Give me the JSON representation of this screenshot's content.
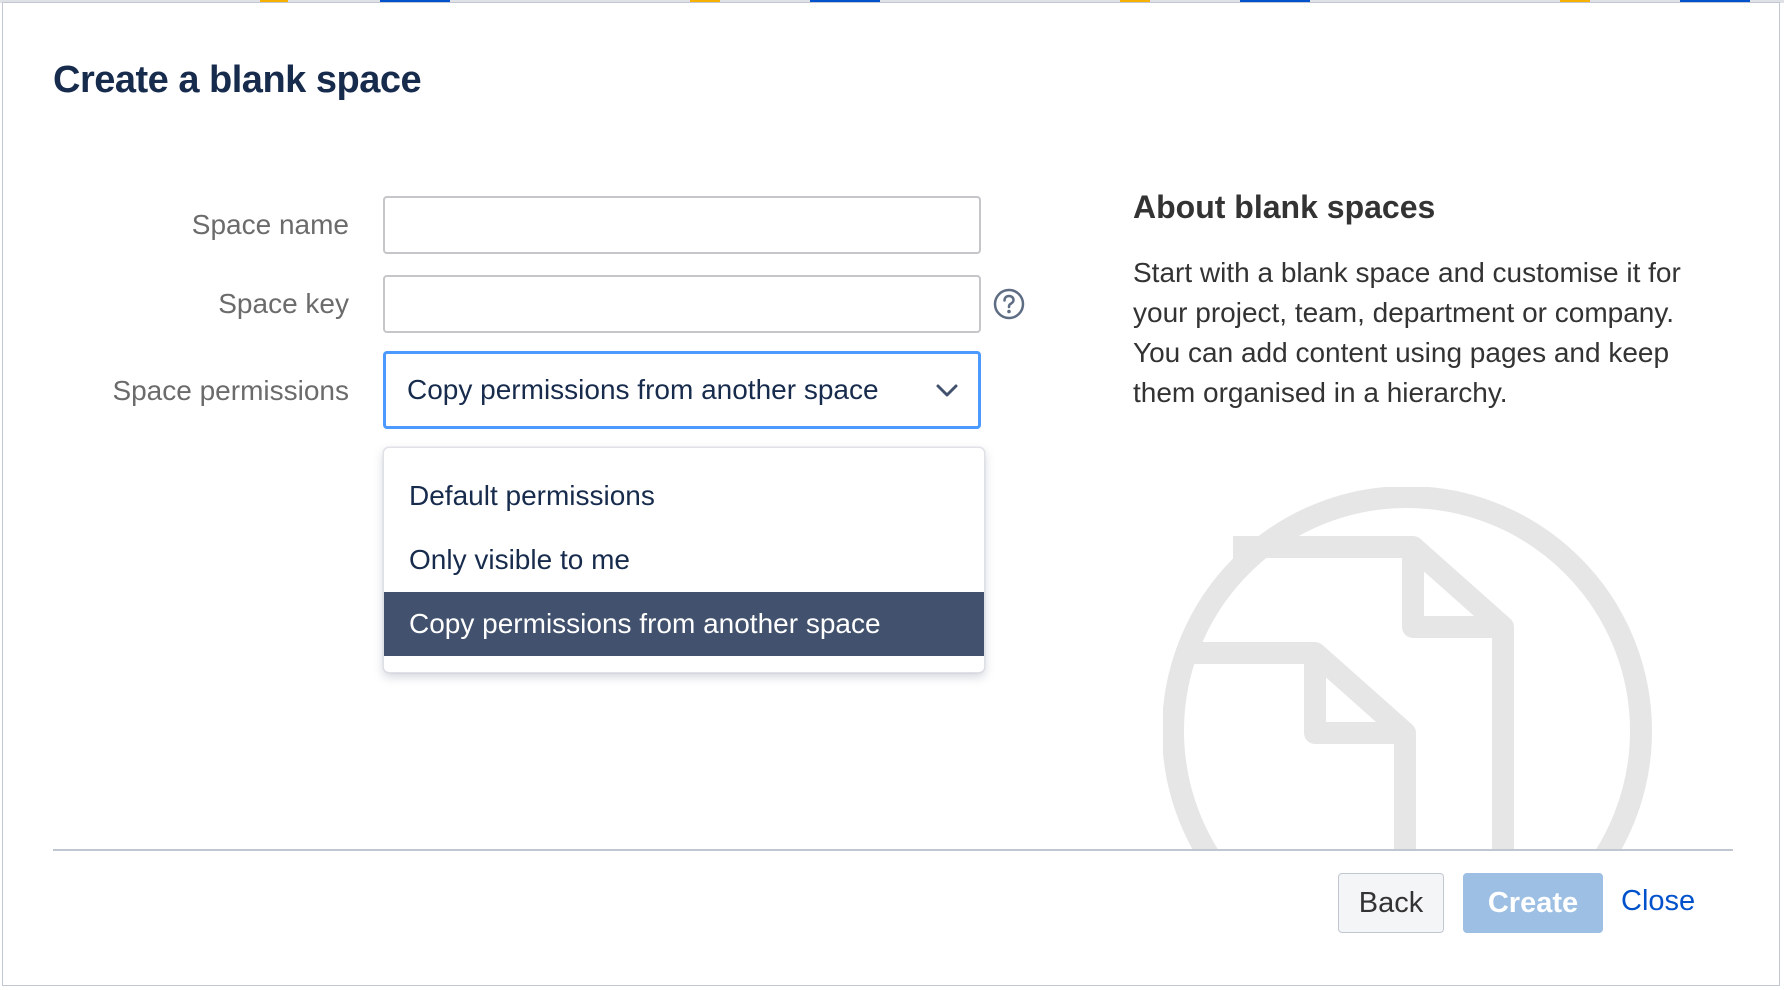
{
  "dialog": {
    "title": "Create a blank space"
  },
  "form": {
    "space_name_label": "Space name",
    "space_name_value": "",
    "space_key_label": "Space key",
    "space_key_value": "",
    "permissions_label": "Space permissions",
    "permissions_selected": "Copy permissions from another space",
    "permission_options": [
      "Default permissions",
      "Only visible to me",
      "Copy permissions from another space"
    ]
  },
  "about": {
    "title": "About blank spaces",
    "text": "Start with a blank space and customise it for your project, team, department or company. You can add content using pages and keep them organised in a hierarchy."
  },
  "footer": {
    "back_label": "Back",
    "create_label": "Create",
    "close_label": "Close"
  },
  "icons": {
    "help": "help-icon",
    "chevron": "chevron-down-icon",
    "illustration": "blank-space-illustration"
  },
  "colors": {
    "focus_border": "#4c9aff",
    "selected_option_bg": "#42526e",
    "create_button_bg": "#9cbfe3",
    "link": "#0052cc",
    "title": "#172b4d"
  }
}
